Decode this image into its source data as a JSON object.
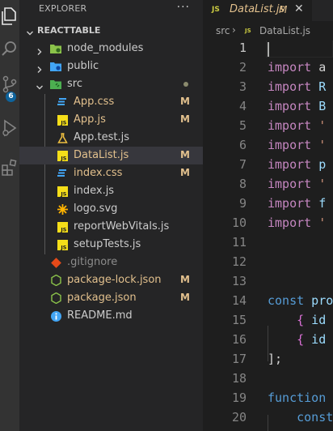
{
  "activity_bar": {
    "items": [
      "explorer-icon",
      "search-icon",
      "source-control-icon",
      "run-debug-icon",
      "extensions-icon"
    ],
    "scm_badge": "6",
    "colors": {
      "background": "#333333",
      "badge": "#0e639c",
      "icon": "#858585",
      "active_icon": "#ffffff"
    }
  },
  "sidebar": {
    "title": "EXPLORER",
    "more_label": "···",
    "root_folder": "REACTTABLE",
    "items": [
      {
        "name": "node_modules",
        "type": "folder",
        "expanded": false,
        "icon": "folder-node-icon",
        "status": ""
      },
      {
        "name": "public",
        "type": "folder",
        "expanded": false,
        "icon": "folder-public-icon",
        "status": ""
      },
      {
        "name": "src",
        "type": "folder",
        "expanded": true,
        "icon": "folder-src-icon",
        "status": "•"
      },
      {
        "name": "App.css",
        "type": "file",
        "icon": "css-file-icon",
        "status": "M"
      },
      {
        "name": "App.js",
        "type": "file",
        "icon": "js-file-icon",
        "status": "M"
      },
      {
        "name": "App.test.js",
        "type": "file",
        "icon": "test-file-icon",
        "status": ""
      },
      {
        "name": "DataList.js",
        "type": "file",
        "icon": "js-file-icon",
        "status": "M",
        "selected": true
      },
      {
        "name": "index.css",
        "type": "file",
        "icon": "css-file-icon",
        "status": "M"
      },
      {
        "name": "index.js",
        "type": "file",
        "icon": "js-file-icon",
        "status": ""
      },
      {
        "name": "logo.svg",
        "type": "file",
        "icon": "svg-file-icon",
        "status": ""
      },
      {
        "name": "reportWebVitals.js",
        "type": "file",
        "icon": "js-file-icon",
        "status": ""
      },
      {
        "name": "setupTests.js",
        "type": "file",
        "icon": "js-file-icon",
        "status": ""
      },
      {
        "name": ".gitignore",
        "type": "file",
        "icon": "git-file-icon",
        "status": ""
      },
      {
        "name": "package-lock.json",
        "type": "file",
        "icon": "node-json-icon",
        "status": "M"
      },
      {
        "name": "package.json",
        "type": "file",
        "icon": "node-json-icon",
        "status": "M"
      },
      {
        "name": "README.md",
        "type": "file",
        "icon": "info-file-icon",
        "status": ""
      }
    ],
    "colors": {
      "background": "#252526",
      "modified": "#e2c08d",
      "selected_row": "#37373d"
    }
  },
  "editor": {
    "tab": {
      "icon_text": "JS",
      "label": "DataList.js",
      "status": "M",
      "close": "✕"
    },
    "breadcrumb": {
      "folder": "src",
      "separator": "›",
      "icon_text": "JS",
      "file": "DataList.js"
    },
    "current_line": 1,
    "lines": [
      {
        "n": "1",
        "tokens": []
      },
      {
        "n": "2",
        "tokens": [
          {
            "t": "kw",
            "v": "import"
          },
          {
            "t": "plain",
            "v": " a"
          }
        ]
      },
      {
        "n": "3",
        "tokens": [
          {
            "t": "kw",
            "v": "import"
          },
          {
            "t": "var",
            "v": " R"
          }
        ]
      },
      {
        "n": "4",
        "tokens": [
          {
            "t": "kw",
            "v": "import"
          },
          {
            "t": "var",
            "v": " B"
          }
        ]
      },
      {
        "n": "5",
        "tokens": [
          {
            "t": "kw",
            "v": "import"
          },
          {
            "t": "str",
            "v": " '"
          }
        ]
      },
      {
        "n": "6",
        "tokens": [
          {
            "t": "kw",
            "v": "import"
          },
          {
            "t": "str",
            "v": " '"
          }
        ]
      },
      {
        "n": "7",
        "tokens": [
          {
            "t": "kw",
            "v": "import"
          },
          {
            "t": "var",
            "v": " p"
          }
        ]
      },
      {
        "n": "8",
        "tokens": [
          {
            "t": "kw",
            "v": "import"
          },
          {
            "t": "str",
            "v": " '"
          }
        ]
      },
      {
        "n": "9",
        "tokens": [
          {
            "t": "kw",
            "v": "import"
          },
          {
            "t": "var",
            "v": " f"
          }
        ]
      },
      {
        "n": "10",
        "tokens": [
          {
            "t": "kw",
            "v": "import"
          },
          {
            "t": "str",
            "v": " '"
          }
        ]
      },
      {
        "n": "11",
        "tokens": []
      },
      {
        "n": "12",
        "tokens": []
      },
      {
        "n": "13",
        "tokens": []
      },
      {
        "n": "14",
        "tokens": [
          {
            "t": "decl",
            "v": "const"
          },
          {
            "t": "var",
            "v": " pro"
          }
        ]
      },
      {
        "n": "15",
        "tokens": [
          {
            "t": "plain",
            "v": "    "
          },
          {
            "t": "brace",
            "v": "{"
          },
          {
            "t": "var",
            "v": " id"
          }
        ]
      },
      {
        "n": "16",
        "tokens": [
          {
            "t": "plain",
            "v": "    "
          },
          {
            "t": "brace",
            "v": "{"
          },
          {
            "t": "var",
            "v": " id"
          }
        ]
      },
      {
        "n": "17",
        "tokens": [
          {
            "t": "punct",
            "v": "];"
          }
        ]
      },
      {
        "n": "18",
        "tokens": []
      },
      {
        "n": "19",
        "tokens": [
          {
            "t": "decl",
            "v": "function"
          }
        ]
      },
      {
        "n": "20",
        "tokens": [
          {
            "t": "plain",
            "v": "    "
          },
          {
            "t": "decl",
            "v": "const"
          }
        ]
      }
    ],
    "colors": {
      "background": "#1e1e1e",
      "keyword": "#c586c0",
      "declaration": "#569cd6",
      "variable": "#9cdcfe",
      "string": "#ce9178",
      "line_number": "#858585"
    }
  }
}
